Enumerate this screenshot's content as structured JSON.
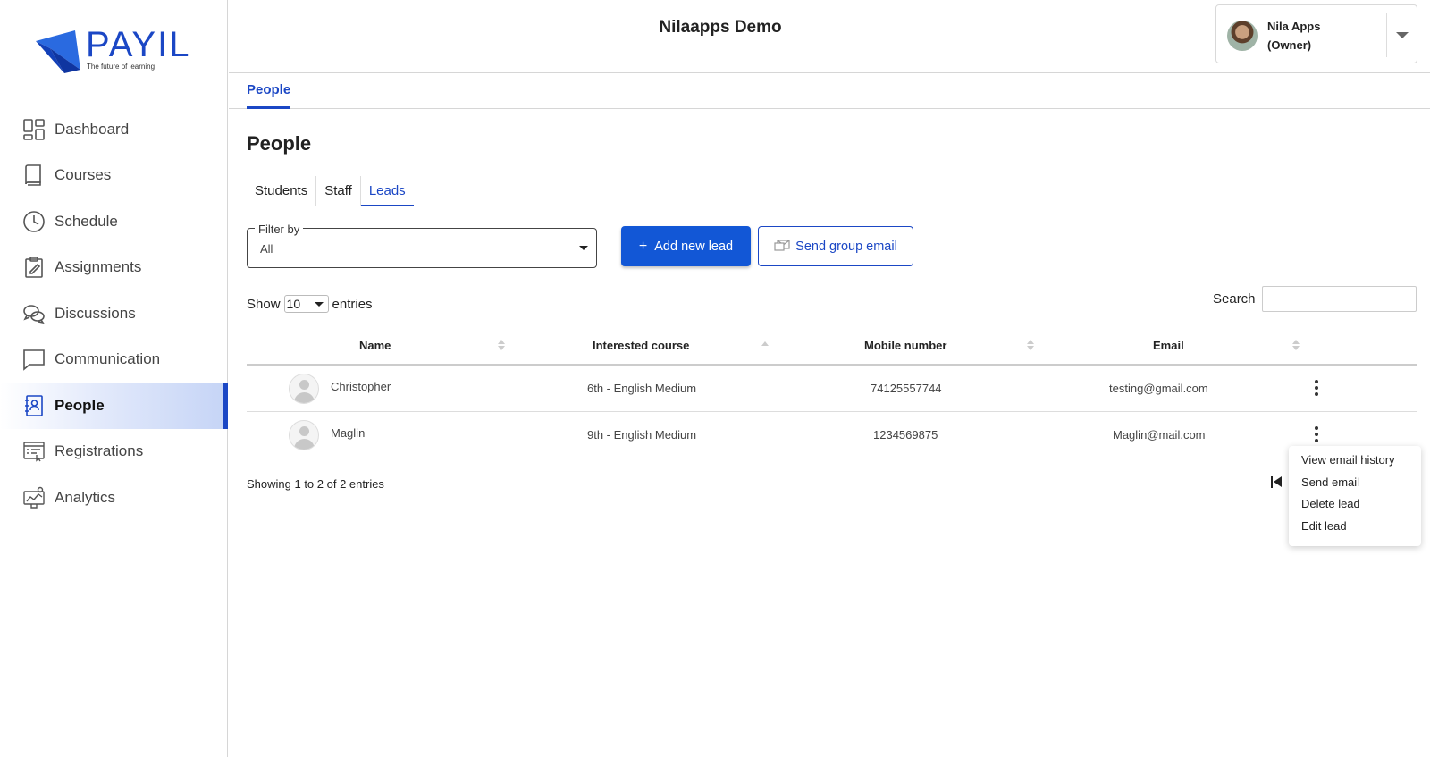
{
  "brand": {
    "name": "PAYIL",
    "tagline": "The future of learning",
    "color": "#1b47c5"
  },
  "sidebar": {
    "items": [
      {
        "label": "Dashboard",
        "icon": "dashboard-icon",
        "active": false
      },
      {
        "label": "Courses",
        "icon": "book-icon",
        "active": false
      },
      {
        "label": "Schedule",
        "icon": "clock-icon",
        "active": false
      },
      {
        "label": "Assignments",
        "icon": "clipboard-icon",
        "active": false
      },
      {
        "label": "Discussions",
        "icon": "chat-bubbles-icon",
        "active": false
      },
      {
        "label": "Communication",
        "icon": "message-square-icon",
        "active": false
      },
      {
        "label": "People",
        "icon": "contact-book-icon",
        "active": true
      },
      {
        "label": "Registrations",
        "icon": "registration-form-icon",
        "active": false
      },
      {
        "label": "Analytics",
        "icon": "analytics-icon",
        "active": false
      }
    ]
  },
  "header": {
    "title": "Nilaapps Demo",
    "user": {
      "name": "Nila Apps",
      "role": "(Owner)"
    }
  },
  "subnav": {
    "tab": "People"
  },
  "page": {
    "title": "People",
    "tabs": [
      {
        "label": "Students",
        "active": false
      },
      {
        "label": "Staff",
        "active": false
      },
      {
        "label": "Leads",
        "active": true
      }
    ],
    "filter": {
      "label": "Filter by",
      "value": "All"
    },
    "add_button": "Add new lead",
    "email_button": "Send group email",
    "show": {
      "prefix": "Show",
      "value": "10",
      "suffix": "entries"
    },
    "search_label": "Search",
    "table": {
      "columns": [
        "Name",
        "Interested course",
        "Mobile number",
        "Email"
      ],
      "rows": [
        {
          "name": "Christopher",
          "course": "6th - English Medium",
          "mobile": "74125557744",
          "email": "testing@gmail.com"
        },
        {
          "name": "Maglin",
          "course": "9th - English Medium",
          "mobile": "1234569875",
          "email": "Maglin@mail.com"
        }
      ]
    },
    "showing": "Showing 1 to 2 of 2 entries",
    "row_menu": [
      "View email history",
      "Send email",
      "Delete lead",
      "Edit lead"
    ]
  }
}
